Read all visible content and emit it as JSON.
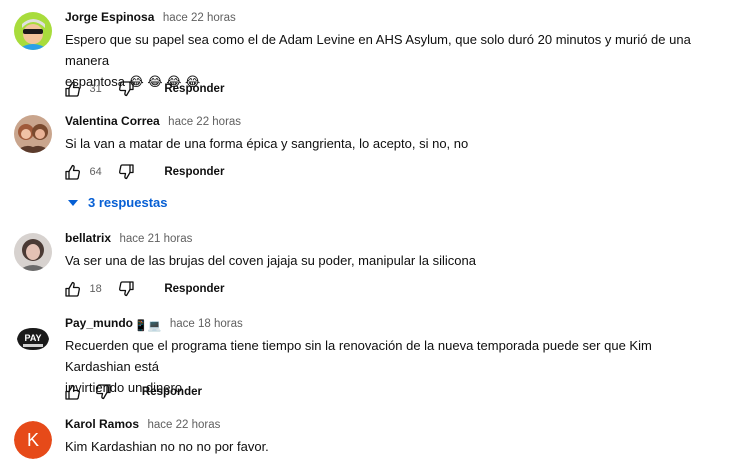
{
  "comments": [
    {
      "author": "Jorge Espinosa",
      "time": "hace 22 horas",
      "text_line1": "Espero que su papel sea como el de Adam Levine en AHS Asylum, que solo duró 20 minutos y murió de una manera",
      "text_line2": "espantosa 😂 😂 😂 😂",
      "likes": "31",
      "reply_label": "Responder",
      "avatar_icon": "cartoon-avatar-icon"
    },
    {
      "author": "Valentina Correa",
      "time": "hace 22 horas",
      "text_line1": "Si la van a matar de una forma épica y sangrienta, lo acepto, si no, no",
      "likes": "64",
      "reply_label": "Responder",
      "replies_label": "3 respuestas",
      "avatar_icon": "photo-avatar-icon"
    },
    {
      "author": "bellatrix",
      "time": "hace 21 horas",
      "text_line1": "Va ser una de las brujas del coven jajaja su poder, manipular la silicona",
      "likes": "18",
      "reply_label": "Responder",
      "avatar_icon": "photo-avatar-icon"
    },
    {
      "author": "Pay_mundo",
      "author_badges": "📱💻",
      "time": "hace 18 horas",
      "text_line1": "Recuerden que el programa tiene tiempo sin la renovación de la nueva temporada puede ser que Kim Kardashian está",
      "text_line2": "invirtiendo un dinero",
      "likes": "",
      "reply_label": "Responder",
      "avatar_text": "PAY",
      "avatar_icon": "logo-avatar-icon"
    },
    {
      "author": "Karol Ramos",
      "time": "hace 22 horas",
      "text_line1": "Kim Kardashian no no no por favor.",
      "avatar_letter": "K",
      "avatar_color": "#e64a19",
      "avatar_icon": "letter-avatar-icon"
    }
  ],
  "colors": {
    "link_blue": "#065fd4",
    "secondary_text": "#606060",
    "primary_text": "#0f0f0f"
  },
  "icons": {
    "like": "thumbs-up-icon",
    "dislike": "thumbs-down-icon",
    "expand": "caret-down-icon"
  }
}
